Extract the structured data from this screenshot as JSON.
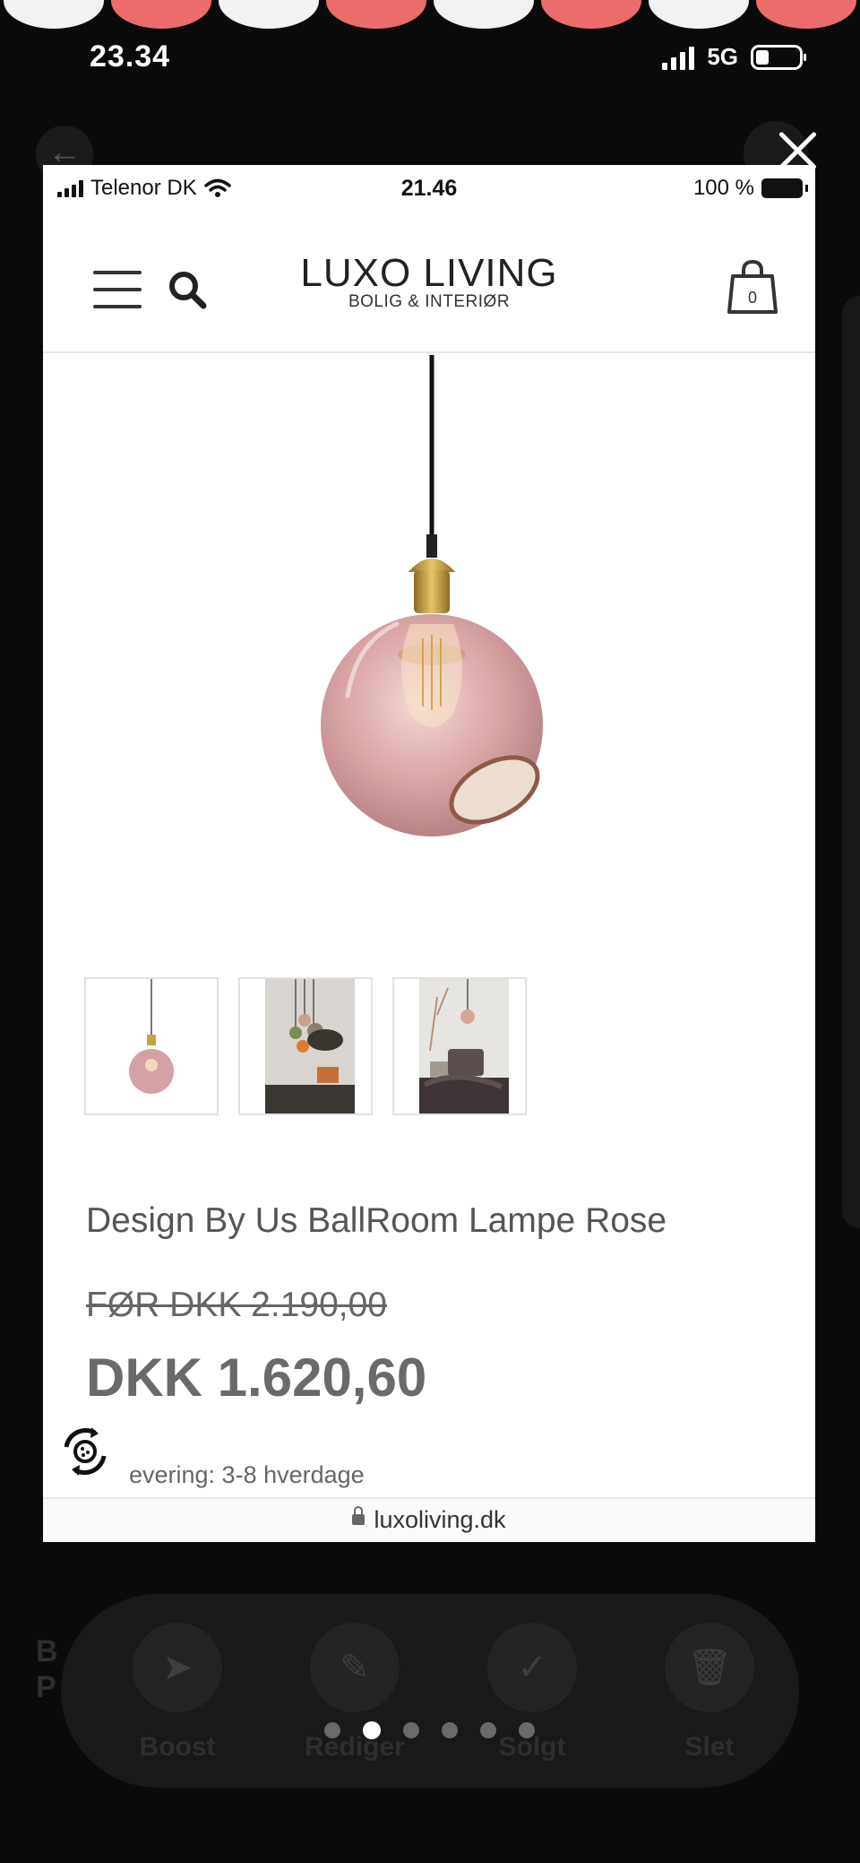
{
  "outer_status": {
    "time": "23.34",
    "network": "5G"
  },
  "inner_status": {
    "carrier": "Telenor DK",
    "time": "21.46",
    "battery": "100 %"
  },
  "site": {
    "brand": "LUXO LIVING",
    "tagline": "BOLIG & INTERIØR",
    "cart_count": "0",
    "url": "luxoliving.dk"
  },
  "product": {
    "title": "Design By Us BallRoom Lampe Rose",
    "old_price": "FØR DKK 2.190,00",
    "price": "DKK 1.620,60",
    "delivery": "evering: 3-8 hverdage"
  },
  "actions": [
    {
      "label": "Boost",
      "icon": "rocket-icon"
    },
    {
      "label": "Rediger",
      "icon": "pencil-icon"
    },
    {
      "label": "Solgt",
      "icon": "check-icon"
    },
    {
      "label": "Slet",
      "icon": "trash-icon"
    }
  ],
  "pager": {
    "count": 6,
    "active_index": 1
  },
  "colors": {
    "accent_red": "#ec6b6b",
    "lamp_rose": "#d9a3a5",
    "brass": "#b8913a"
  }
}
